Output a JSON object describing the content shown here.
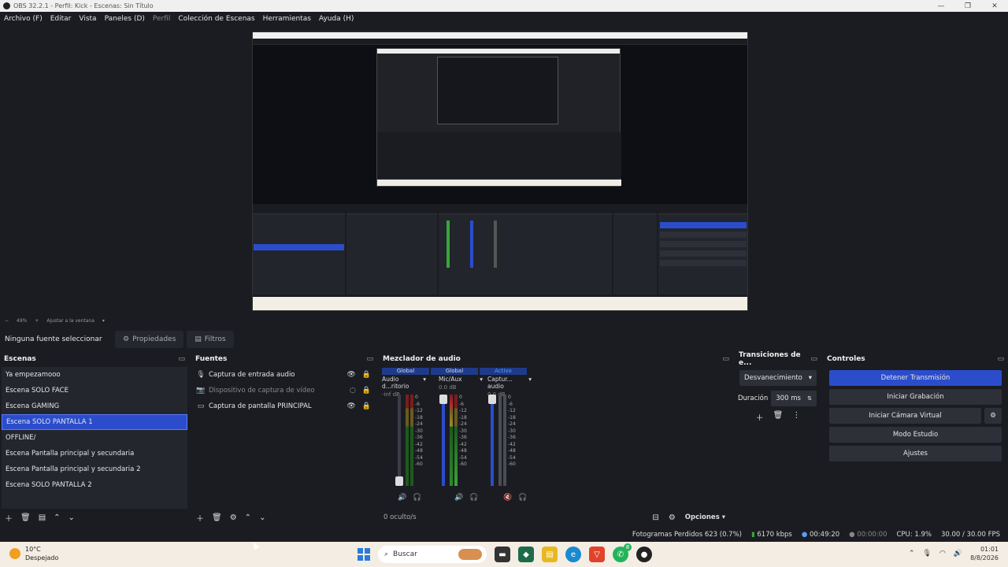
{
  "window": {
    "title": "OBS 32.2.1 - Perfil: Kick - Escenas: Sin Título",
    "controls": [
      "—",
      "❐",
      "✕"
    ]
  },
  "menu": [
    "Archivo (F)",
    "Editar",
    "Vista",
    "Paneles (D)",
    "Perfil",
    "Colección de Escenas",
    "Herramientas",
    "Ayuda (H)"
  ],
  "zoombar": {
    "minus": "−",
    "zoom": "49%",
    "plus": "+",
    "fit": "Ajustar a la ventana",
    "arrow": "▾"
  },
  "properties_bar": {
    "no_source": "Ninguna fuente seleccionar",
    "properties_label": "Propiedades",
    "filters_label": "Filtros"
  },
  "scenes": {
    "title": "Escenas",
    "items": [
      "Ya empezamooo",
      "Escena SOLO FACE",
      "Escena GAMING",
      "Escena SOLO PANTALLA 1",
      "OFFLINE/",
      "Escena Pantalla principal y secundaria",
      "Escena Pantalla principal y secundaria 2",
      "Escena SOLO PANTALLA 2"
    ],
    "selected_index": 3
  },
  "sources": {
    "title": "Fuentes",
    "items": [
      {
        "label": "Captura de entrada audio",
        "icon": "microphone-icon",
        "visible": true
      },
      {
        "label": "Dispositivo de captura de vídeo",
        "icon": "camera-icon",
        "visible": false
      },
      {
        "label": "Captura de pantalla PRINCIPAL",
        "icon": "monitor-icon",
        "visible": true
      }
    ]
  },
  "mixer": {
    "title": "Mezclador de audio",
    "headers": [
      "Global",
      "Global",
      "Activo"
    ],
    "channels": [
      {
        "name": "Audio d...ritorio",
        "db": "-inf dB",
        "level": 0.0
      },
      {
        "name": "Mic/Aux",
        "db": "0.0 dB",
        "level": 0.92
      },
      {
        "name": "Captur... audio",
        "db": "0.0 dB",
        "level": 0.92
      }
    ],
    "ticks": [
      "0",
      "-6",
      "-12",
      "-18",
      "-24",
      "-30",
      "-36",
      "-42",
      "-48",
      "-54",
      "-60"
    ],
    "hidden": "0 oculto/s",
    "options": "Opciones"
  },
  "transitions": {
    "title": "Transiciones de e...",
    "type": "Desvanecimiento",
    "duration_label": "Duración",
    "duration_value": "300 ms"
  },
  "controls": {
    "title": "Controles",
    "stop_stream": "Detener Transmisión",
    "start_record": "Iniciar Grabación",
    "virtual_cam": "Iniciar Cámara Virtual",
    "studio_mode": "Modo Estudio",
    "settings": "Ajustes"
  },
  "status": {
    "dropped": "Fotogramas Perdidos 623 (0.7%)",
    "bitrate": "6170 kbps",
    "stream_time": "00:49:20",
    "record_time": "00:00:00",
    "cpu": "CPU: 1.9%",
    "fps": "30.00 / 30.00 FPS"
  },
  "taskbar": {
    "temp": "10°C",
    "weather": "Despejado",
    "search": "Buscar",
    "time": "01:01",
    "date": "8/8/2026",
    "badge": "8"
  },
  "colors": {
    "accent": "#2b4dcc",
    "background": "#1b1c22",
    "panel": "#24262d",
    "meter_green": "#3aa53a",
    "meter_red": "#c23030"
  }
}
